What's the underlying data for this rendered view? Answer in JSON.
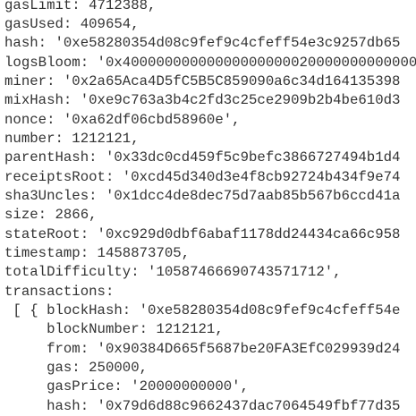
{
  "console": {
    "lines": [
      "gasLimit: 4712388,",
      "gasUsed: 409654,",
      "hash: '0xe58280354d08c9fef9c4cfeff54e3c9257db65",
      "logsBloom: '0x400000000000000000000200000000000000",
      "miner: '0x2a65Aca4D5fC5B5C859090a6c34d164135398",
      "mixHash: '0xe9c763a3b4c2fd3c25ce2909b2b4be610d3",
      "nonce: '0xa62df06cbd58960e',",
      "number: 1212121,",
      "parentHash: '0x33dc0cd459f5c9befc3866727494b1d4",
      "receiptsRoot: '0xcd45d340d3e4f8cb92724b434f9e74",
      "sha3Uncles: '0x1dcc4de8dec75d7aab85b567b6ccd41a",
      "size: 2866,",
      "stateRoot: '0xc929d0dbf6abaf1178dd24434ca66c958",
      "timestamp: 1458873705,",
      "totalDifficulty: '10587466690743571712',",
      "transactions:",
      " [ { blockHash: '0xe58280354d08c9fef9c4cfeff54e",
      "     blockNumber: 1212121,",
      "     from: '0x90384D665f5687be20FA3EfC029939d24",
      "     gas: 250000,",
      "     gasPrice: '20000000000',",
      "     hash: '0x79d6d88c9662437dac7064549fbf77d35"
    ]
  }
}
